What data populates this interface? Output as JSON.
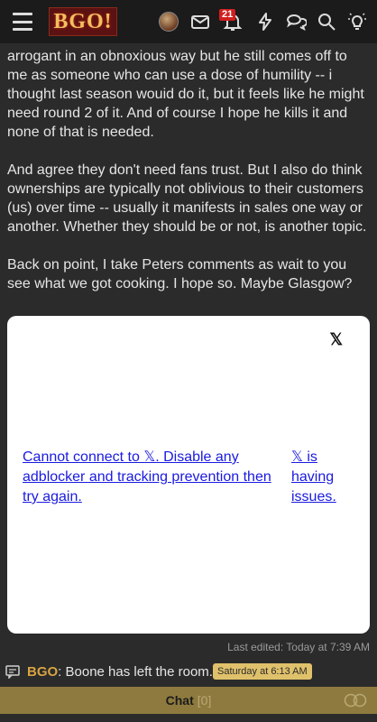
{
  "header": {
    "logo_text": "BGO!",
    "notification_count": "21",
    "icons": [
      "menu-icon",
      "avatar",
      "mail-icon",
      "bell-icon",
      "bolt-icon",
      "chat-bubbles-icon",
      "search-icon",
      "lightbulb-icon"
    ]
  },
  "post": {
    "partial_top_line": "arrogant in an obnoxious way but he still comes off to me as someone who can use a dose of humility -- i thought last season wouid do it, but it feels like he might need round 2 of it. And of course I hope he kills it and none of that is needed.",
    "paragraph2": "And agree they don't need fans trust. But I also do think ownerships are typically not oblivious to their customers (us) over time -- usually it manifests in sales one way or another. Whether they should be or not, is another topic.",
    "paragraph3": "Back on point, I take Peters comments as wait to you see what we got cooking. I hope so. Maybe Glasgow?"
  },
  "embed": {
    "x_logo": "𝕏",
    "message": "Cannot connect to 𝕏. Disable any adblocker and tracking prevention then try again.",
    "issue_link": "𝕏 is having issues."
  },
  "last_edited": "Last edited: Today at 7:39 AM",
  "shoutbox": {
    "user": "BGO",
    "separator": ":",
    "message": " Boone has left the room.",
    "time": "Saturday at 6:13 AM"
  },
  "chat": {
    "label": "Chat",
    "count": "[0]"
  },
  "colors": {
    "background": "#2b2b2b",
    "topbar": "#1b1b1b",
    "accent_gold": "#d9a441",
    "chatbar": "#8e7a3e",
    "badge_red": "#d21f1f",
    "link_blue": "#1a1ae0"
  }
}
